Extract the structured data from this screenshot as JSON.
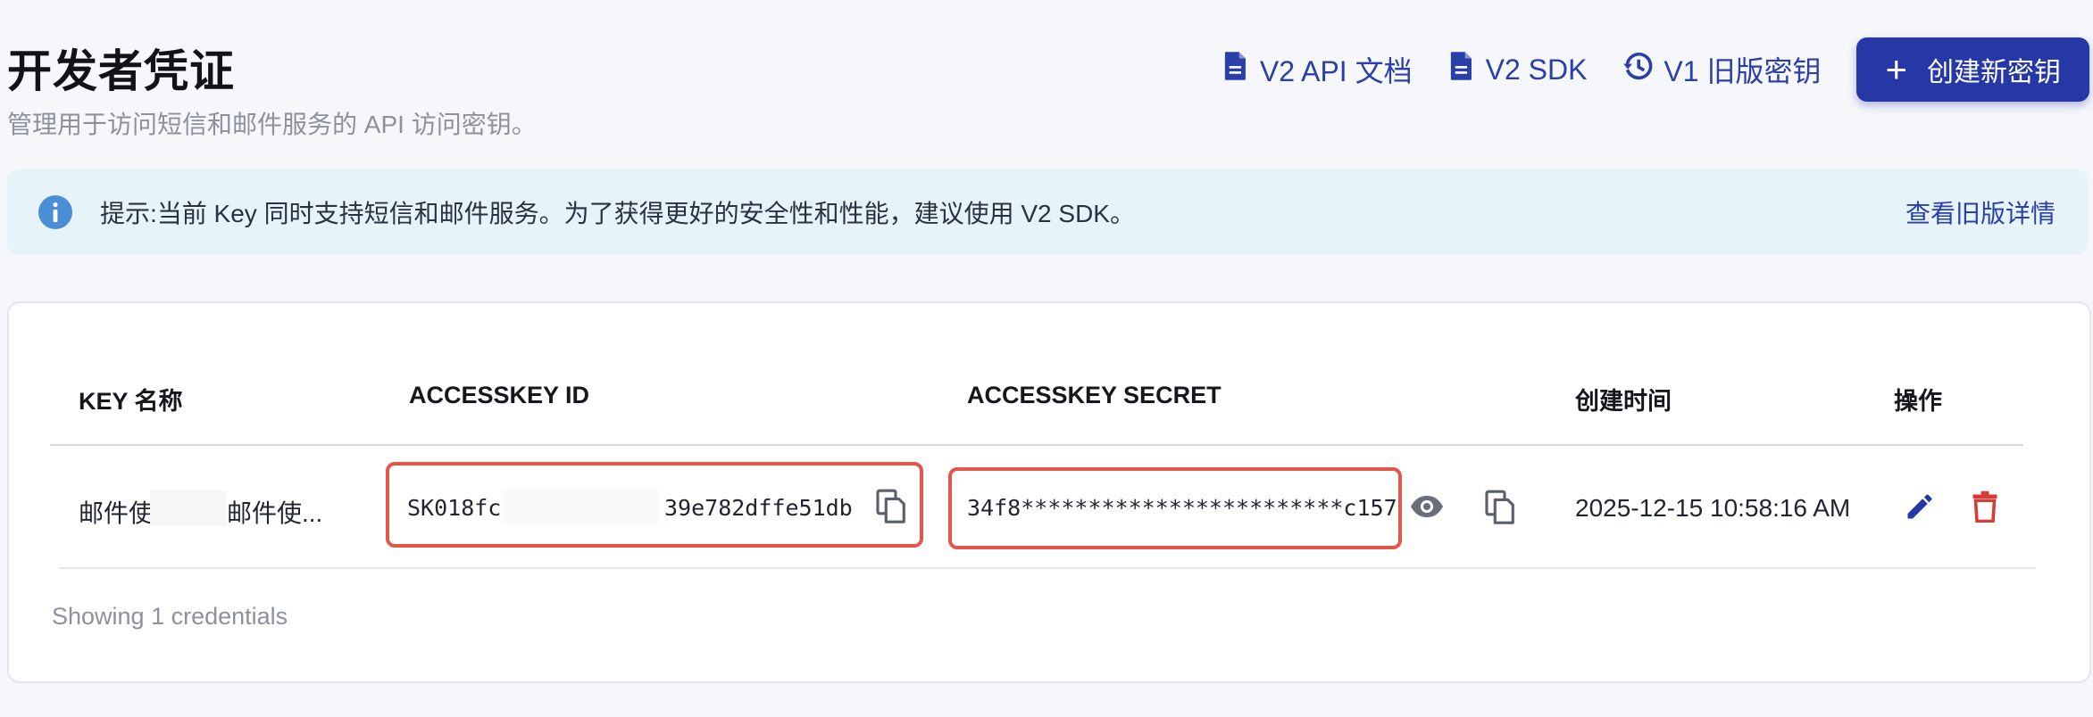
{
  "header": {
    "title": "开发者凭证",
    "subtitle": "管理用于访问短信和邮件服务的 API 访问密钥。",
    "links": {
      "api_docs": "V2 API 文档",
      "sdk": "V2 SDK",
      "v1_keys": "V1 旧版密钥"
    },
    "create_button": "创建新密钥"
  },
  "banner": {
    "text": "提示:当前 Key 同时支持短信和邮件服务。为了获得更好的安全性和性能，建议使用 V2 SDK。",
    "link": "查看旧版详情"
  },
  "table": {
    "columns": [
      "KEY 名称",
      "ACCESSKEY ID",
      "ACCESSKEY SECRET",
      "创建时间",
      "操作"
    ],
    "rows": [
      {
        "name_left": "邮件使",
        "name_right": "邮件使...",
        "access_key_id_left": "SK018fc",
        "access_key_id_right": "39e782dffe51db",
        "access_key_secret": "34f8************************c157",
        "created_at": "2025-12-15 10:58:16 AM"
      }
    ]
  },
  "footer": {
    "count_text": "Showing 1 credentials"
  },
  "colors": {
    "accent": "#2637a6",
    "link": "#2a3fa8",
    "highlight_border": "#e2564b",
    "delete": "#d63b35",
    "info": "#4a8ed8"
  },
  "icons": [
    "document-icon",
    "history-icon",
    "plus-icon",
    "info-icon",
    "copy-icon",
    "eye-icon",
    "edit-icon",
    "delete-icon"
  ]
}
